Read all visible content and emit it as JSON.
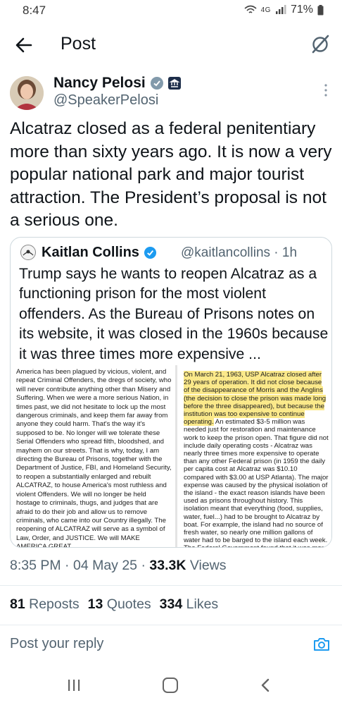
{
  "status_bar": {
    "time": "8:47",
    "network": "4G",
    "battery": "71%"
  },
  "header": {
    "title": "Post"
  },
  "author": {
    "name": "Nancy Pelosi",
    "handle": "@SpeakerPelosi"
  },
  "tweet": {
    "text": "Alcatraz closed as a federal penitentiary more than sixty years ago. It is now a very popular national park and major tourist attraction. The President’s proposal is not a serious one."
  },
  "quote": {
    "name": "Kaitlan Collins",
    "handle": "@kaitlancollins",
    "time": "· 1h",
    "text": "Trump says he wants to reopen Alcatraz as a functioning prison for the most violent offenders. As the Bureau of Prisons notes on its website, it was closed in the 1960s because it was three times more expensive ...",
    "image_left_text": "America has been plagued by vicious, violent, and repeat Criminal Offenders, the dregs of society, who will never contribute anything other than Misery and Suffering. When we were a more serious Nation, in times past, we did not hesitate to lock up the most dangerous criminals, and keep them far away from anyone they could harm. That's the way it's supposed to be. No longer will we tolerate these Serial Offenders who spread filth, bloodshed, and mayhem on our streets. That is why, today, I am directing the Bureau of Prisons, together with the Department of Justice, FBI, and Homeland Security, to reopen a substantially enlarged and rebuilt ALCATRAZ, to house America's most ruthless and violent Offenders. We will no longer be held hostage to criminals, thugs, and judges that are afraid to do their job and allow us to remove criminals, who came into our Country illegally. The reopening of ALCATRAZ will serve as a symbol of Law, Order, and JUSTICE. We will MAKE AMERICA GREAT",
    "image_right_highlight": "On March 21, 1963, USP Alcatraz closed after 29 years of operation. It did not close because of the disappearance of Morris and the Anglins (the decision to close the prison was made long before the three disappeared), but because the institution was too expensive to continue operating.",
    "image_right_text": " An estimated $3-5 million was needed just for restoration and maintenance work to keep the prison open. That figure did not include daily operating costs - Alcatraz was nearly three times more expensive to operate than any other Federal prison (in 1959 the daily per capita cost at Alcatraz was $10.10 compared with $3.00 at USP Atlanta). The major expense was caused by the physical isolation of the island - the exact reason islands have been used as prisons throughout history. This isolation meant that everything (food, supplies, water, fuel...) had to be brought to Alcatraz by boat. For example, the island had no source of fresh water, so nearly one million gallons of water had to be barged to the island each week. The Federal Government found that it was more cost-effective to build a new institution than to keep Alcatraz open."
  },
  "meta": {
    "time": "8:35 PM",
    "date": "04 May 25",
    "views_count": "33.3K",
    "views_label": "Views",
    "sep": "·"
  },
  "stats": {
    "reposts_count": "81",
    "reposts_label": "Reposts",
    "quotes_count": "13",
    "quotes_label": "Quotes",
    "likes_count": "334",
    "likes_label": "Likes"
  },
  "reply": {
    "placeholder": "Post your reply"
  },
  "colors": {
    "verified": "#1d9bf0",
    "text": "#0f1419",
    "secondary": "#536471",
    "highlight": "#fbe98a"
  },
  "icons": {
    "back": "arrow-left-icon",
    "grok": "grok-icon",
    "verified": "verified-badge-icon",
    "gov": "government-badge-icon",
    "more": "more-vertical-icon",
    "camera": "camera-icon"
  }
}
